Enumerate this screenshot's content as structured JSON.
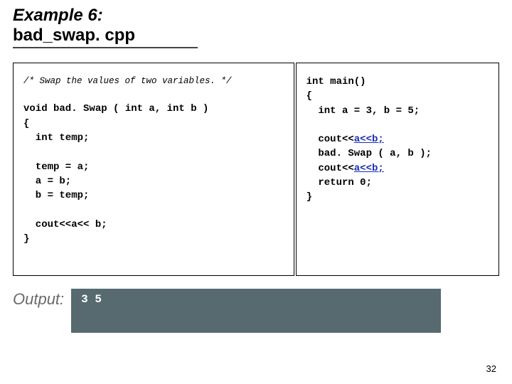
{
  "title": {
    "line1": "Example 6:",
    "line2": "bad_swap. cpp"
  },
  "code_left": {
    "comment": "/* Swap the values of two variables. */",
    "l1": "void bad. Swap ( int a, int b )",
    "l2": "{",
    "l3": "  int temp;",
    "l4": "  temp = a;",
    "l5": "  a = b;",
    "l6": "  b = temp;",
    "l7": "  cout<<a<< b;",
    "l8": "}"
  },
  "code_right": {
    "l1": "int main()",
    "l2": "{",
    "l3": "  int a = 3, b = 5;",
    "cout_prefix": "  cout<<",
    "cout_link": "a<<b;",
    "l5": "  bad. Swap ( a, b );",
    "l7": "  return 0;",
    "l8": "}"
  },
  "output": {
    "label": "Output:",
    "text": "3  5"
  },
  "page": "32"
}
